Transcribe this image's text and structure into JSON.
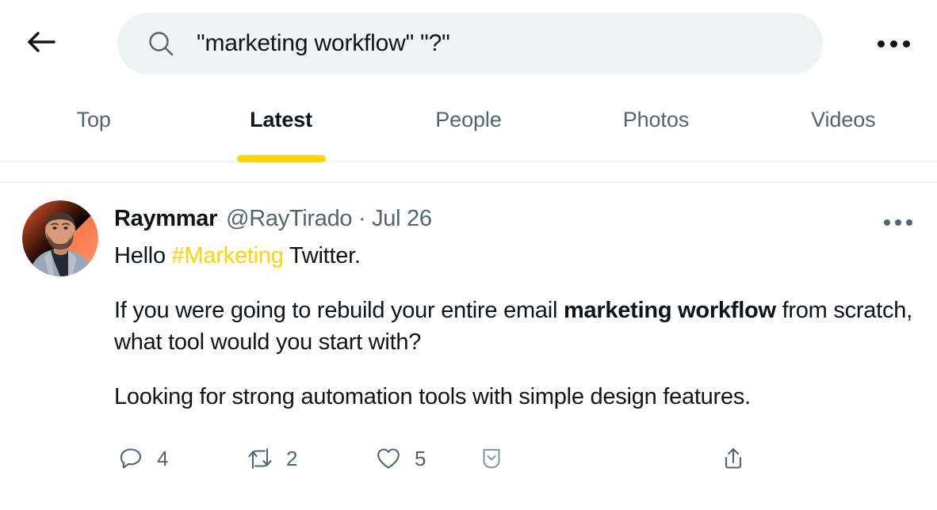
{
  "topbar": {
    "back_icon": "arrow-left-icon",
    "search": {
      "icon": "search-icon",
      "value": "\"marketing workflow\" \"?\"",
      "placeholder": "Search Twitter"
    },
    "overflow_label": "more-options"
  },
  "tabs": [
    {
      "label": "Top",
      "active": false
    },
    {
      "label": "Latest",
      "active": true
    },
    {
      "label": "People",
      "active": false
    },
    {
      "label": "Photos",
      "active": false
    },
    {
      "label": "Videos",
      "active": false
    }
  ],
  "tweet": {
    "avatar_alt": "Raymmar profile photo",
    "display_name": "Raymmar",
    "handle": "@RayTirado",
    "separator": "·",
    "timestamp": "Jul 26",
    "handle_line": "@RayTirado · Jul 26",
    "menu_label": "tweet-more-options",
    "paragraphs": [
      {
        "runs": [
          {
            "text": "Hello ",
            "style": "normal"
          },
          {
            "text": "#Marketing",
            "style": "hashtag"
          },
          {
            "text": " Twitter.",
            "style": "normal"
          }
        ]
      },
      {
        "runs": [
          {
            "text": "If you were going to rebuild your entire email ",
            "style": "normal"
          },
          {
            "text": "marketing workflow",
            "style": "bold"
          },
          {
            "text": " from scratch, what tool would you start with?",
            "style": "normal"
          }
        ]
      },
      {
        "runs": [
          {
            "text": "Looking for strong automation tools with simple design features.",
            "style": "normal"
          }
        ]
      }
    ],
    "text_line1": "Hello ",
    "hashtag": "#Marketing",
    "text_line1_end": " Twitter.",
    "text_p2_a": "If you were going to rebuild your entire email ",
    "text_p2_bold": "marketing workflow",
    "text_p2_b": " from scratch, what tool would you start with?",
    "text_p3": "Looking for strong automation tools with simple design features.",
    "actions": {
      "reply": {
        "icon": "reply-icon",
        "count": "4"
      },
      "retweet": {
        "icon": "retweet-icon",
        "count": "2"
      },
      "like": {
        "icon": "heart-icon",
        "count": "5"
      },
      "bookmark": {
        "icon": "bookmark-chevron-icon",
        "count": ""
      },
      "share": {
        "icon": "share-icon",
        "count": ""
      }
    }
  },
  "colors": {
    "accent_yellow": "#ffd400",
    "text_primary": "#0f1419",
    "text_secondary": "#536471",
    "search_bg": "#eff3f4",
    "divider": "#eff3f4"
  }
}
